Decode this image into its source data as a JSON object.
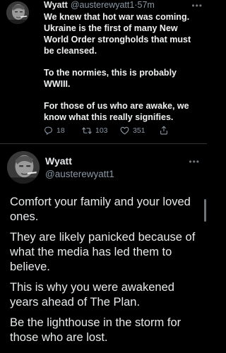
{
  "tweet1": {
    "author_name": "Wyatt",
    "author_handle": "@austerewyatt1",
    "separator": "·",
    "time": "57m",
    "more_icon": "more-horizontal-icon",
    "paragraphs": [
      "We knew that hot war was coming. Ukraine is the first of many New World Order strongholds that must be cleansed.",
      "To the normies, this is probably WWIII.",
      "For those of us who are awake, we know what this really signifies."
    ],
    "stats": {
      "replies": "18",
      "retweets": "103",
      "likes": "351"
    }
  },
  "tweet2": {
    "author_name": "Wyatt",
    "author_handle": "@austerewyatt1",
    "more_icon": "more-horizontal-icon",
    "paragraphs": [
      "Comfort your family and your loved ones.",
      "They are likely panicked because of what the media has led them to believe.",
      "This is why you were awakened years ahead of The Plan.",
      "Be the lighthouse in the storm for those who are lost."
    ]
  },
  "colors": {
    "background": "#000000",
    "text": "#e7e9ea",
    "secondary_text": "#8b98a5",
    "divider": "#2f3336"
  }
}
